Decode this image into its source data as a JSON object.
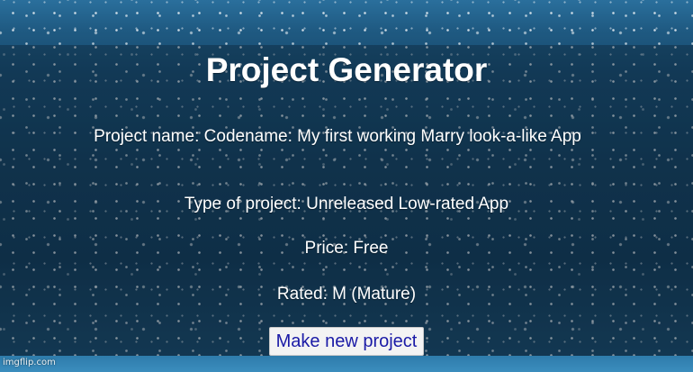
{
  "page": {
    "title": "Project Generator"
  },
  "project": {
    "name_label": "Project name:",
    "name_value": "Codename: My first working Marry look-a-like App",
    "type_label": "Type of project:",
    "type_value": "Unreleased Low-rated App",
    "price_label": "Price:",
    "price_value": "Free",
    "rated_label": "Rated:",
    "rated_value": "M (Mature)"
  },
  "actions": {
    "make_new_label": "Make new project"
  },
  "watermark": {
    "text": "imgflip.com"
  },
  "colors": {
    "background": "#174a6e",
    "text": "#ffffff",
    "button_text": "#1a1aa6",
    "button_bg": "#f3f3f3"
  }
}
